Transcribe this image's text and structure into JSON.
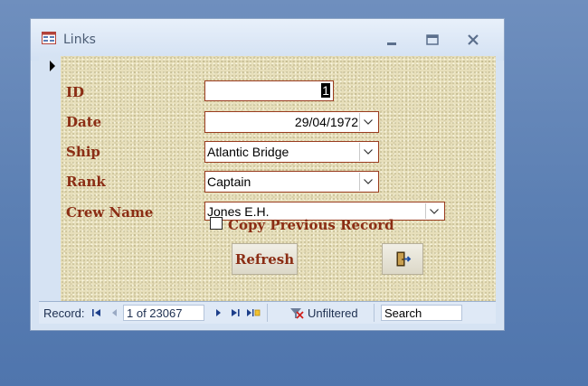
{
  "window": {
    "title": "Links",
    "icon": "form-icon",
    "controls": [
      "minimize-icon",
      "maximize-icon",
      "close-icon"
    ]
  },
  "form": {
    "id_label": "ID",
    "id_value": "1",
    "date_label": "Date",
    "date_value": "29/04/1972",
    "ship_label": "Ship",
    "ship_value": "Atlantic Bridge",
    "rank_label": "Rank",
    "rank_value": "Captain",
    "crew_label": "Crew Name",
    "crew_value": "Jones E.H.",
    "copy_previous_label": "Copy Previous Record",
    "copy_previous_checked": false,
    "refresh_label": "Refresh",
    "exit_icon": "exit-door-icon"
  },
  "navbar": {
    "record_label": "Record:",
    "record_position": "1 of 23067",
    "filter_label": "Unfiltered",
    "search_placeholder": "Search"
  },
  "colors": {
    "label_text": "#8b2d14",
    "field_border": "#9a3c1f",
    "form_background": "#e7dfbb",
    "desktop": "#5b7fb3"
  }
}
